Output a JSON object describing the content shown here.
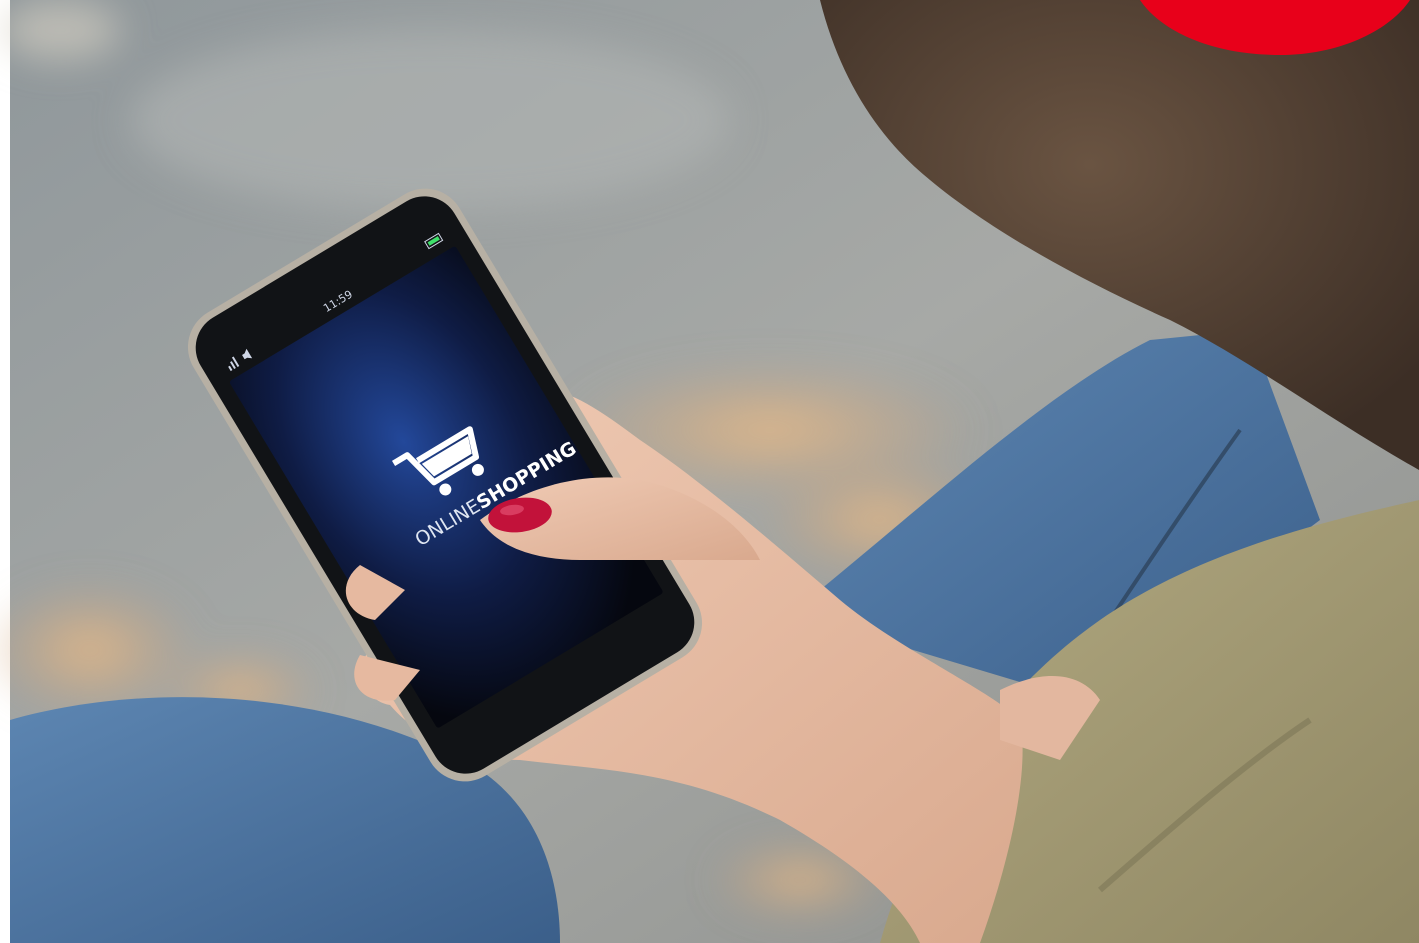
{
  "phone_screen": {
    "status_time": "11:59",
    "brand_text_1": "ONLINE",
    "brand_text_2": "SHOPPING",
    "cart_icon": "shopping-cart-icon",
    "signal_icon": "signal-icon",
    "sound_icon": "speaker-icon",
    "battery_icon": "battery-icon"
  },
  "colors": {
    "background_gray": "#9aa0a3",
    "denim": "#4f77a3",
    "jacket": "#a59c74",
    "hair": "#4a3a30",
    "screen_dark": "#0c1020",
    "screen_glow": "#1d3c8a",
    "nail_polish": "#c2123a",
    "corner_badge": "#e8001a",
    "skin": "#e9c1a8"
  }
}
